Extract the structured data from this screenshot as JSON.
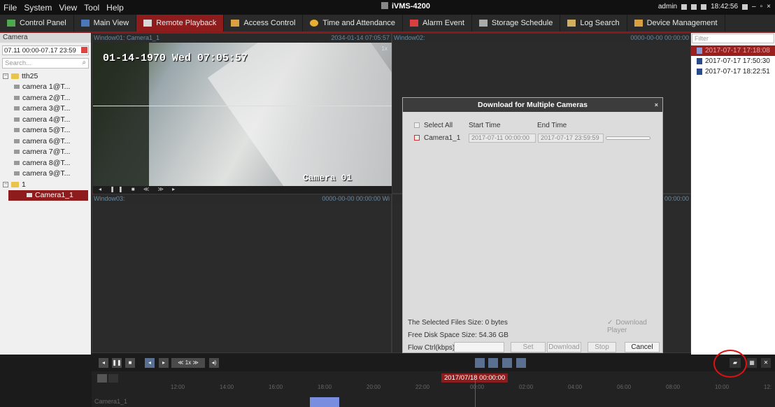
{
  "menu": [
    "File",
    "System",
    "View",
    "Tool",
    "Help"
  ],
  "app_title": "iVMS-4200",
  "top_right": {
    "user": "admin",
    "time": "18:42:56"
  },
  "tabs": [
    {
      "label": "Control Panel",
      "color": "#4fa84f"
    },
    {
      "label": "Main View",
      "color": "#4a78b8"
    },
    {
      "label": "Remote Playback",
      "color": "#d8d8d8",
      "active": true
    },
    {
      "label": "Access Control",
      "color": "#d8a040"
    },
    {
      "label": "Time and Attendance",
      "color": "#e8b030"
    },
    {
      "label": "Alarm Event",
      "color": "#d84040"
    },
    {
      "label": "Storage Schedule",
      "color": "#aaaaaa"
    },
    {
      "label": "Log Search",
      "color": "#d0b060"
    },
    {
      "label": "Device Management",
      "color": "#d8a040"
    }
  ],
  "left": {
    "header": "Camera",
    "date_range": "07.11 00:00-07.17 23:59",
    "search_placeholder": "Search...",
    "groups": [
      {
        "name": "tth25",
        "items": [
          "camera 1@T...",
          "camera 2@T...",
          "camera 3@T...",
          "camera 4@T...",
          "camera 5@T...",
          "camera 6@T...",
          "camera 7@T...",
          "camera 8@T...",
          "camera 9@T..."
        ]
      },
      {
        "name": "1",
        "items": [
          "Camera1_1"
        ]
      }
    ]
  },
  "windows": {
    "w1": {
      "title": "Window01: Camera1_1",
      "time": "2034-01-14 07:05:57",
      "osd_time": "01-14-1970 Wed 07:05:57",
      "osd_camera": "Camera 01",
      "speed": "1x"
    },
    "w2": {
      "title": "Window02:",
      "time": "0000-00-00 00:00:00"
    },
    "w3": {
      "title": "Window03:",
      "time": "0000-00-00 00:00:00",
      "extra": "Wi"
    },
    "w4": {
      "title": "",
      "time": "00:00:00"
    }
  },
  "right": {
    "filter_placeholder": "Filter",
    "records": [
      "2017-07-17 17:18:08",
      "2017-07-17 17:50:30",
      "2017-07-17 18:22:51"
    ]
  },
  "dialog": {
    "title": "Download for Multiple Cameras",
    "select_all": "Select All",
    "col_start": "Start Time",
    "col_end": "End Time",
    "camera": "Camera1_1",
    "start": "2017-07-11 00:00:00",
    "end": "2017-07-17 23:59:59",
    "selected_size": "The Selected Files Size: 0 bytes",
    "download_player": "Download Player",
    "free_space": "Free Disk Space Size: 54.36 GB",
    "flow_label": "Flow Ctrl(kbps):",
    "buttons": {
      "set": "Set",
      "download": "Download",
      "stop": "Stop",
      "cancel": "Cancel"
    }
  },
  "controls": {
    "speed": "1x"
  },
  "timeline": {
    "date": "2017/07/18 00:00:00",
    "ticks": [
      "12:00",
      "14:00",
      "16:00",
      "18:00",
      "20:00",
      "22:00",
      "00:00",
      "02:00",
      "04:00",
      "06:00",
      "08:00",
      "10:00",
      "12:"
    ],
    "camera_label": "Camera1_1"
  }
}
